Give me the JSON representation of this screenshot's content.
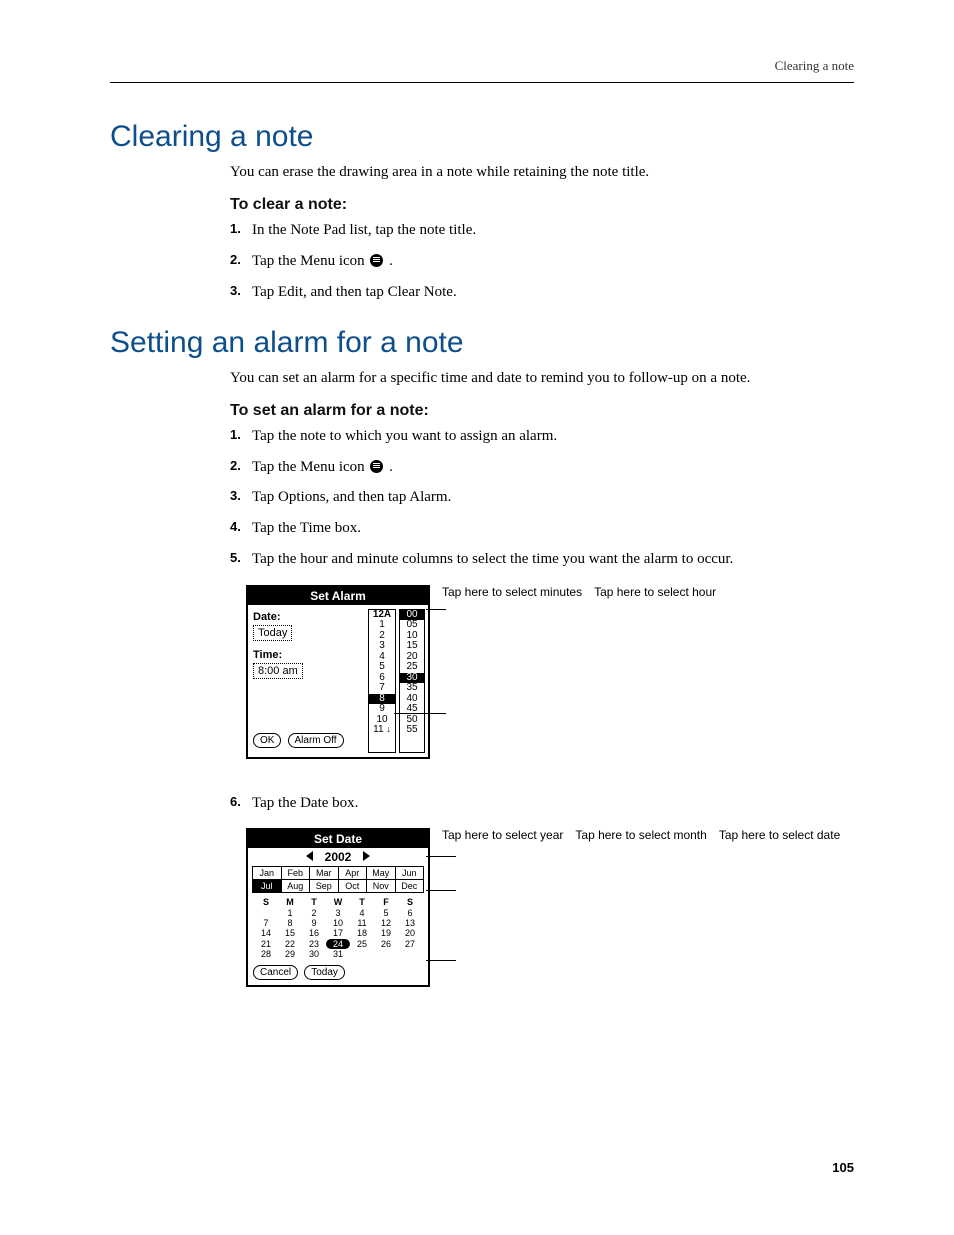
{
  "runningHead": "Clearing a note",
  "pageNumber": "105",
  "section1": {
    "heading": "Clearing a note",
    "intro": "You can erase the drawing area in a note while retaining the note title.",
    "subhead": "To clear a note:",
    "steps": [
      "In the Note Pad list, tap the note title.",
      "Tap the Menu icon",
      "Tap Edit, and then tap Clear Note."
    ]
  },
  "section2": {
    "heading": "Setting an alarm for a note",
    "intro": "You can set an alarm for a specific time and date to remind you to follow-up on a note.",
    "subhead": "To set an alarm for a note:",
    "steps": [
      "Tap the note to which you want to assign an alarm.",
      "Tap the Menu icon",
      "Tap Options, and then tap Alarm.",
      "Tap the Time box.",
      "Tap the hour and minute columns to select the time you want the alarm to occur."
    ],
    "step6": "Tap the Date box."
  },
  "setAlarm": {
    "title": "Set Alarm",
    "dateLabel": "Date:",
    "dateValue": "Today",
    "timeLabel": "Time:",
    "timeValue": "8:00 am",
    "ok": "OK",
    "alarmOff": "Alarm Off",
    "hoursHeader": "12A",
    "hours": [
      "1",
      "2",
      "3",
      "4",
      "5",
      "6",
      "7",
      "8",
      "9",
      "10",
      "11"
    ],
    "selectedHour": "8",
    "arrow": "↓",
    "minutes": [
      "00",
      "05",
      "10",
      "15",
      "20",
      "25",
      "30",
      "35",
      "40",
      "45",
      "50",
      "55"
    ],
    "callouts": {
      "minutes": "Tap here to select minutes",
      "hour": "Tap here to select hour"
    }
  },
  "setDate": {
    "title": "Set Date",
    "year": "2002",
    "months": [
      "Jan",
      "Feb",
      "Mar",
      "Apr",
      "May",
      "Jun",
      "Jul",
      "Aug",
      "Sep",
      "Oct",
      "Nov",
      "Dec"
    ],
    "selectedMonth": "Jul",
    "dow": [
      "S",
      "M",
      "T",
      "W",
      "T",
      "F",
      "S"
    ],
    "weeks": [
      [
        "",
        "1",
        "2",
        "3",
        "4",
        "5",
        "6"
      ],
      [
        "7",
        "8",
        "9",
        "10",
        "11",
        "12",
        "13"
      ],
      [
        "14",
        "15",
        "16",
        "17",
        "18",
        "19",
        "20"
      ],
      [
        "21",
        "22",
        "23",
        "24",
        "25",
        "26",
        "27"
      ],
      [
        "28",
        "29",
        "30",
        "31",
        "",
        "",
        ""
      ]
    ],
    "today": "24",
    "cancel": "Cancel",
    "todayBtn": "Today",
    "callouts": {
      "year": "Tap here to select year",
      "month": "Tap here to select month",
      "date": "Tap here to select date"
    }
  }
}
